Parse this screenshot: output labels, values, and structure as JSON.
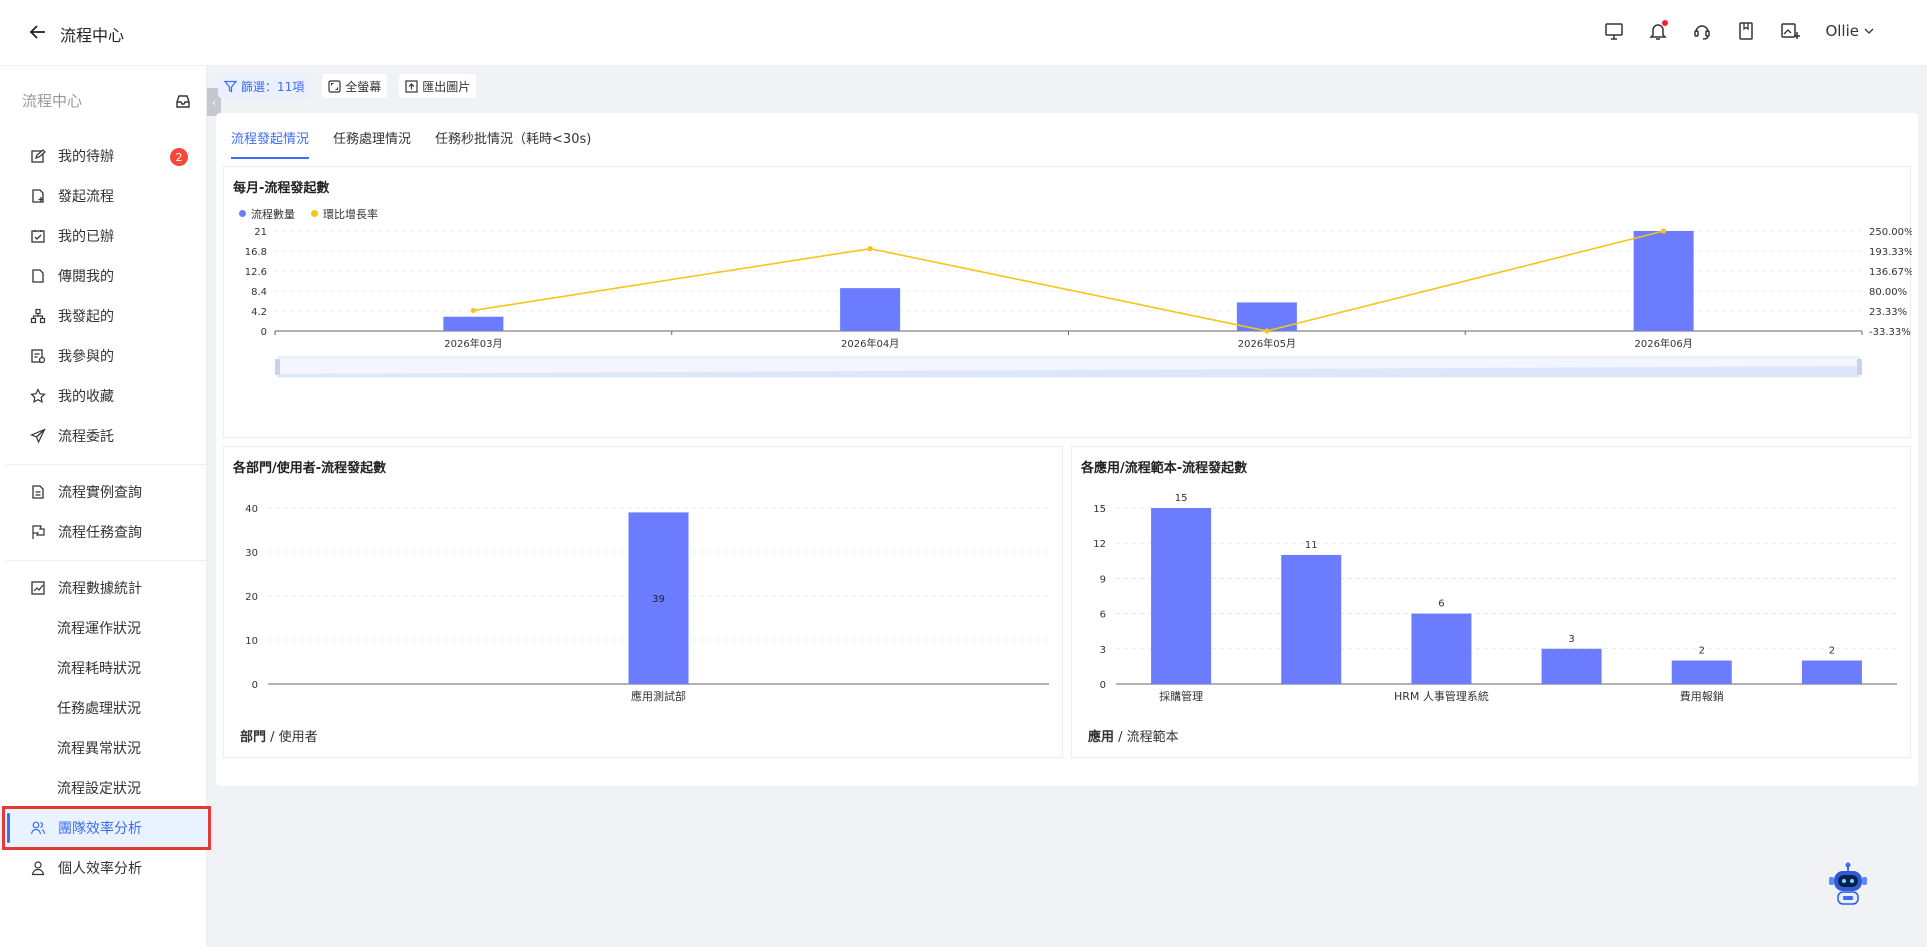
{
  "header": {
    "title": "流程中心",
    "user": "Ollie"
  },
  "sidebar": {
    "title": "流程中心",
    "todo_badge": "2",
    "items": [
      {
        "label": "我的待辦",
        "icon": "edit-icon"
      },
      {
        "label": "發起流程",
        "icon": "file-add-icon"
      },
      {
        "label": "我的已辦",
        "icon": "check-square-icon"
      },
      {
        "label": "傳閱我的",
        "icon": "file-icon"
      },
      {
        "label": "我發起的",
        "icon": "org-chart-icon"
      },
      {
        "label": "我參與的",
        "icon": "participate-icon"
      },
      {
        "label": "我的收藏",
        "icon": "star-icon"
      },
      {
        "label": "流程委託",
        "icon": "send-icon"
      },
      {
        "label": "流程實例查詢",
        "icon": "document-icon"
      },
      {
        "label": "流程任務查詢",
        "icon": "flag-icon"
      },
      {
        "label": "流程數據統計",
        "icon": "line-chart-icon"
      },
      {
        "label": "流程運作狀況"
      },
      {
        "label": "流程耗時狀況"
      },
      {
        "label": "任務處理狀況"
      },
      {
        "label": "流程異常狀況"
      },
      {
        "label": "流程設定狀況"
      },
      {
        "label": "團隊效率分析",
        "icon": "team-icon"
      },
      {
        "label": "個人效率分析",
        "icon": "user-icon"
      }
    ]
  },
  "toolbar": {
    "filter": "篩選：11項",
    "fullscreen": "全螢幕",
    "export": "匯出圖片"
  },
  "tabs": [
    "流程發起情況",
    "任務處理情況",
    "任務秒批情況（耗時<30s)"
  ],
  "colors": {
    "accent": "#3d6df0",
    "bar": "#6b7cff",
    "line": "#f5c518"
  },
  "chart_data": [
    {
      "type": "bar",
      "title": "每月-流程發起數",
      "categories": [
        "2026年03月",
        "2026年04月",
        "2026年05月",
        "2026年06月"
      ],
      "series": [
        {
          "name": "流程數量",
          "type": "bar",
          "axis": "left",
          "values": [
            3,
            9,
            6,
            21
          ]
        },
        {
          "name": "環比增長率",
          "type": "line",
          "axis": "right",
          "values": [
            25,
            200,
            -33.33,
            250
          ]
        }
      ],
      "ylim_left": [
        0,
        21
      ],
      "yticks_left": [
        "0",
        "4.2",
        "8.4",
        "12.6",
        "16.8",
        "21"
      ],
      "ylim_right": [
        -33.33,
        250
      ],
      "yticks_right": [
        "-33.33%",
        "23.33%",
        "80.00%",
        "136.67%",
        "193.33%",
        "250.00%"
      ],
      "grid": true,
      "legend": "top-left"
    },
    {
      "type": "bar",
      "title": "各部門/使用者-流程發起數",
      "categories": [
        "應用測試部"
      ],
      "values": [
        39
      ],
      "data_labels": [
        "39"
      ],
      "ylim": [
        0,
        40
      ],
      "yticks": [
        "0",
        "10",
        "20",
        "30",
        "40"
      ],
      "xlabel_bold": "部門",
      "xlabel_rest": " / 使用者",
      "grid": true
    },
    {
      "type": "bar",
      "title": "各應用/流程範本-流程發起數",
      "categories": [
        "採購管理",
        "",
        "HRM 人事管理系統",
        "",
        "費用報銷",
        ""
      ],
      "values": [
        15,
        11,
        6,
        3,
        2,
        2
      ],
      "data_labels": [
        "15",
        "11",
        "6",
        "3",
        "2",
        "2"
      ],
      "ylim": [
        0,
        15
      ],
      "yticks": [
        "0",
        "3",
        "6",
        "9",
        "12",
        "15"
      ],
      "xlabel_bold": "應用",
      "xlabel_rest": " / 流程範本",
      "grid": true
    }
  ]
}
